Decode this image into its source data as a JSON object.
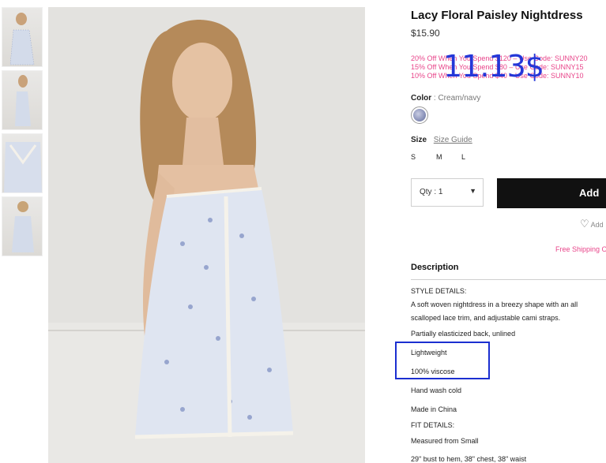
{
  "product": {
    "title": "Lacy Floral Paisley Nightdress",
    "price": "$15.90",
    "overlay_price": "11.13$"
  },
  "promos": [
    "20% Off When You Spend $120 – Use Code: SUNNY20",
    "15% Off When You Spend $80 – Use Code: SUNNY15",
    "10% Off When You Spend $40 – Use Code: SUNNY10"
  ],
  "color": {
    "label": "Color",
    "separator": ":",
    "value": "Cream/navy"
  },
  "size": {
    "label": "Size",
    "guide": "Size Guide",
    "options": [
      "S",
      "M",
      "L"
    ]
  },
  "qty": {
    "label": "Qty : 1"
  },
  "add_label": "Add",
  "wishlist_label": "Add",
  "free_shipping": "Free Shipping O",
  "description": {
    "title": "Description",
    "lines": [
      "STYLE DETAILS:",
      "A soft woven nightdress in a breezy shape with an all",
      "scalloped lace trim, and adjustable cami straps.",
      "Partially elasticized back, unlined",
      "Lightweight",
      "100% viscose",
      "Hand wash cold",
      "Made in China",
      "FIT DETAILS:",
      "Measured from Small",
      "29\" bust to hem, 38\" chest, 38\" waist"
    ]
  },
  "colors": {
    "promo": "#e8458a",
    "overlay": "#2437d8",
    "button": "#111111"
  }
}
